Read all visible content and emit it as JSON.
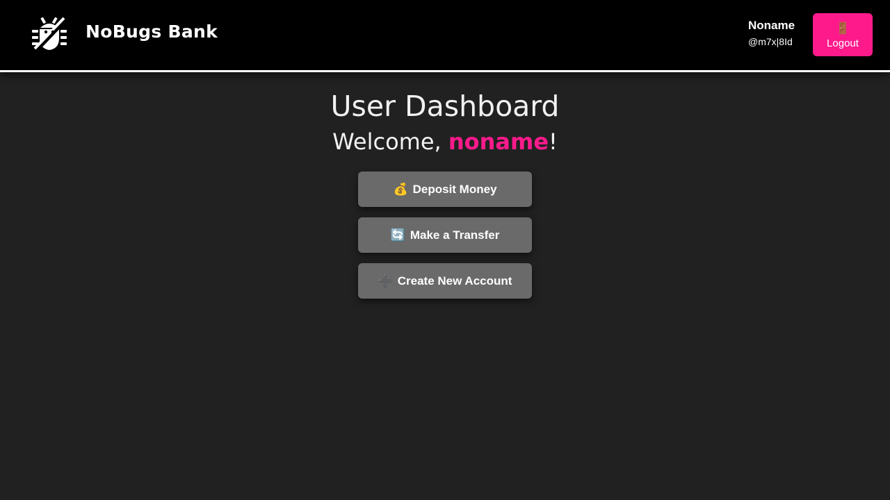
{
  "header": {
    "brand": "NoBugs Bank",
    "logo_icon": "bug-slash-icon",
    "user": {
      "name": "Noname",
      "handle": "@m7x|8Id"
    },
    "logout": {
      "icon": "🚪",
      "label": "Logout"
    }
  },
  "main": {
    "title": "User Dashboard",
    "welcome_prefix": "Welcome, ",
    "welcome_name": "noname",
    "welcome_suffix": "!",
    "actions": [
      {
        "icon": "💰",
        "label": "Deposit Money"
      },
      {
        "icon": "🔄",
        "label": "Make a Transfer"
      },
      {
        "icon": "➕",
        "label": "Create New Account"
      }
    ]
  },
  "colors": {
    "accent": "#ff1a8c",
    "background": "#212121",
    "header": "#000000",
    "button": "#6a6a6a"
  }
}
